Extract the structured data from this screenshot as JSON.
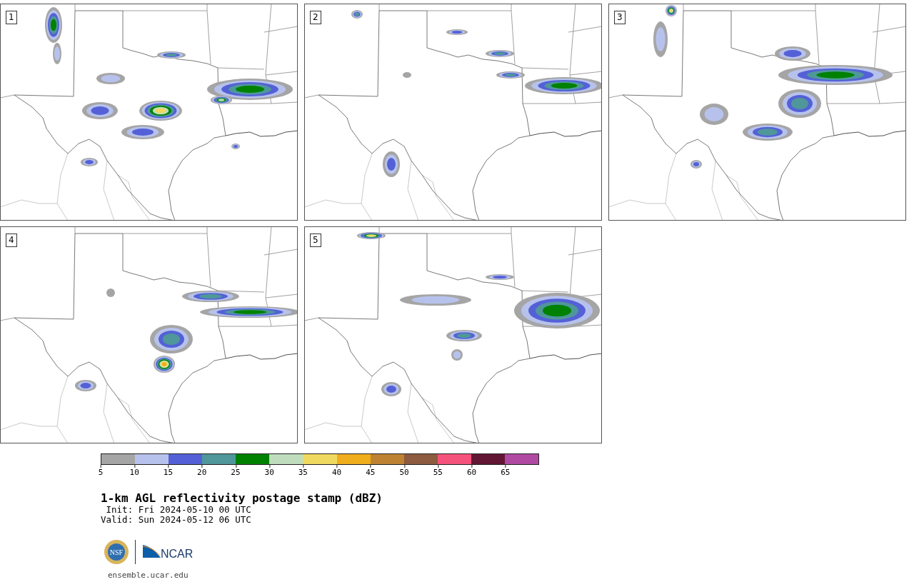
{
  "panels": [
    {
      "label": "1"
    },
    {
      "label": "2"
    },
    {
      "label": "3"
    },
    {
      "label": "4"
    },
    {
      "label": "5"
    }
  ],
  "colorbar": {
    "bins": [
      {
        "color": "#a5a5a5"
      },
      {
        "color": "#b7c2ec"
      },
      {
        "color": "#5461d6"
      },
      {
        "color": "#4f979b"
      },
      {
        "color": "#008100"
      },
      {
        "color": "#bfddbd"
      },
      {
        "color": "#efd95e"
      },
      {
        "color": "#f0ad1c"
      },
      {
        "color": "#bd8232"
      },
      {
        "color": "#8d5b3f"
      },
      {
        "color": "#f5527c"
      },
      {
        "color": "#631634"
      },
      {
        "color": "#ae4aa2"
      }
    ],
    "ticks": [
      "5",
      "10",
      "15",
      "20",
      "25",
      "30",
      "35",
      "40",
      "45",
      "50",
      "55",
      "60",
      "65"
    ]
  },
  "title": "1-km AGL reflectivity postage stamp (dBZ)",
  "init": " Init: Fri 2024-05-10 00 UTC",
  "valid": "Valid: Sun 2024-05-12 06 UTC",
  "logos": {
    "nsf": "NSF",
    "ncar": "NCAR"
  },
  "url": "ensemble.ucar.edu"
}
